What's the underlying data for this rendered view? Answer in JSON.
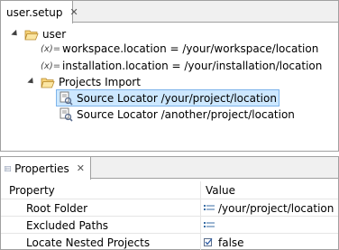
{
  "editor": {
    "tab_label": "user.setup",
    "tree": {
      "root_label": "user",
      "variables": [
        "workspace.location = /your/workspace/location",
        "installation.location = /your/installation/location"
      ],
      "projects_import_label": "Projects Import",
      "locators": [
        "Source Locator /your/project/location",
        "Source Locator /another/project/location"
      ],
      "variable_icon_text": "(x)="
    }
  },
  "properties": {
    "tab_label": "Properties",
    "headers": {
      "property": "Property",
      "value": "Value"
    },
    "rows": [
      {
        "property": "Root Folder",
        "value": "/your/project/location",
        "icon": "list-icon"
      },
      {
        "property": "Excluded Paths",
        "value": "",
        "icon": "list-icon"
      },
      {
        "property": "Locate Nested Projects",
        "value": "false",
        "icon": "checkbox-icon"
      }
    ]
  },
  "colors": {
    "selection_bg": "#cde8ff",
    "selection_border": "#7eb4ea",
    "border": "#a0a0a0"
  }
}
